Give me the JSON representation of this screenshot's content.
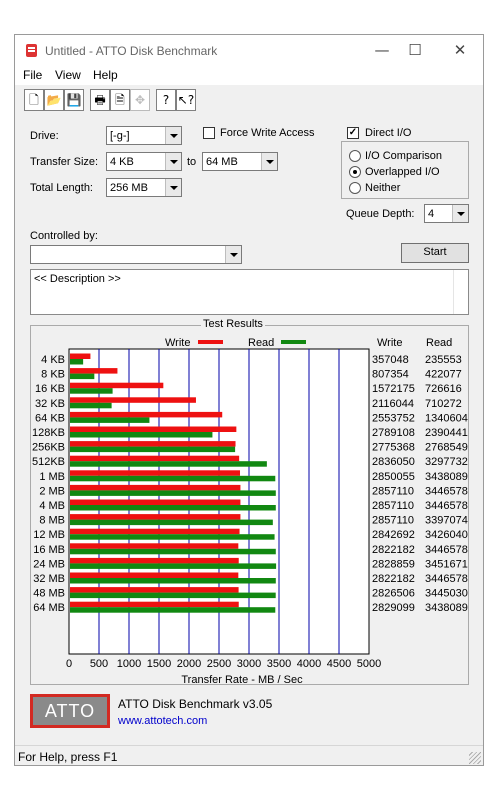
{
  "window": {
    "title": "Untitled - ATTO Disk Benchmark",
    "minimize": "—",
    "maximize": "☐",
    "close": "✕"
  },
  "menu": [
    "File",
    "View",
    "Help"
  ],
  "toolbar": [
    "new-icon",
    "open-icon",
    "save-icon",
    "print-icon",
    "print-preview-icon",
    "move-icon",
    "help-icon",
    "context-help-icon"
  ],
  "settings": {
    "drive_label": "Drive:",
    "drive_value": "[-g-]",
    "transfer_size_label": "Transfer Size:",
    "transfer_from": "4 KB",
    "to_label": "to",
    "transfer_to": "64 MB",
    "total_length_label": "Total Length:",
    "total_length": "256 MB",
    "force_write_access": "Force Write Access",
    "direct_io": "Direct I/O",
    "io_comparison": "I/O Comparison",
    "overlapped_io": "Overlapped I/O",
    "neither": "Neither",
    "queue_depth_label": "Queue Depth:",
    "queue_depth": "4",
    "controlled_by_label": "Controlled by:",
    "controlled_by_value": "",
    "start": "Start",
    "description": "<< Description >>"
  },
  "results": {
    "title": "Test Results",
    "legend_write": "Write",
    "legend_read": "Read",
    "col_write": "Write",
    "col_read": "Read",
    "write_color": "#ee1111",
    "read_color": "#118811"
  },
  "chart_data": {
    "type": "bar",
    "orientation": "horizontal",
    "categories": [
      "4 KB",
      "8 KB",
      "16 KB",
      "32 KB",
      "64 KB",
      "128KB",
      "256KB",
      "512KB",
      "1 MB",
      "2 MB",
      "4 MB",
      "8 MB",
      "12 MB",
      "16 MB",
      "24 MB",
      "32 MB",
      "48 MB",
      "64 MB"
    ],
    "series": [
      {
        "name": "Write",
        "values": [
          357048,
          807354,
          1572175,
          2116044,
          2553752,
          2789108,
          2775368,
          2836050,
          2850055,
          2857110,
          2857110,
          2857110,
          2842692,
          2822182,
          2828859,
          2822182,
          2826506,
          2829099
        ]
      },
      {
        "name": "Read",
        "values": [
          235553,
          422077,
          726616,
          710272,
          1340604,
          2390441,
          2768549,
          3297732,
          3438089,
          3446578,
          3446578,
          3397074,
          3426040,
          3446578,
          3451671,
          3446578,
          3445030,
          3438089
        ]
      }
    ],
    "xlabel": "Transfer Rate - MB / Sec",
    "xticks": [
      "0",
      "500",
      "1000",
      "1500",
      "2000",
      "2500",
      "3000",
      "3500",
      "4000",
      "4500",
      "5000"
    ],
    "xlim": [
      0,
      5000
    ],
    "value_unit_note_scale": 1000,
    "grid": true,
    "legend": "top"
  },
  "branding": {
    "logo": "ATTO",
    "product": "ATTO Disk Benchmark v3.05",
    "url": "www.attotech.com"
  },
  "status": "For Help, press F1"
}
